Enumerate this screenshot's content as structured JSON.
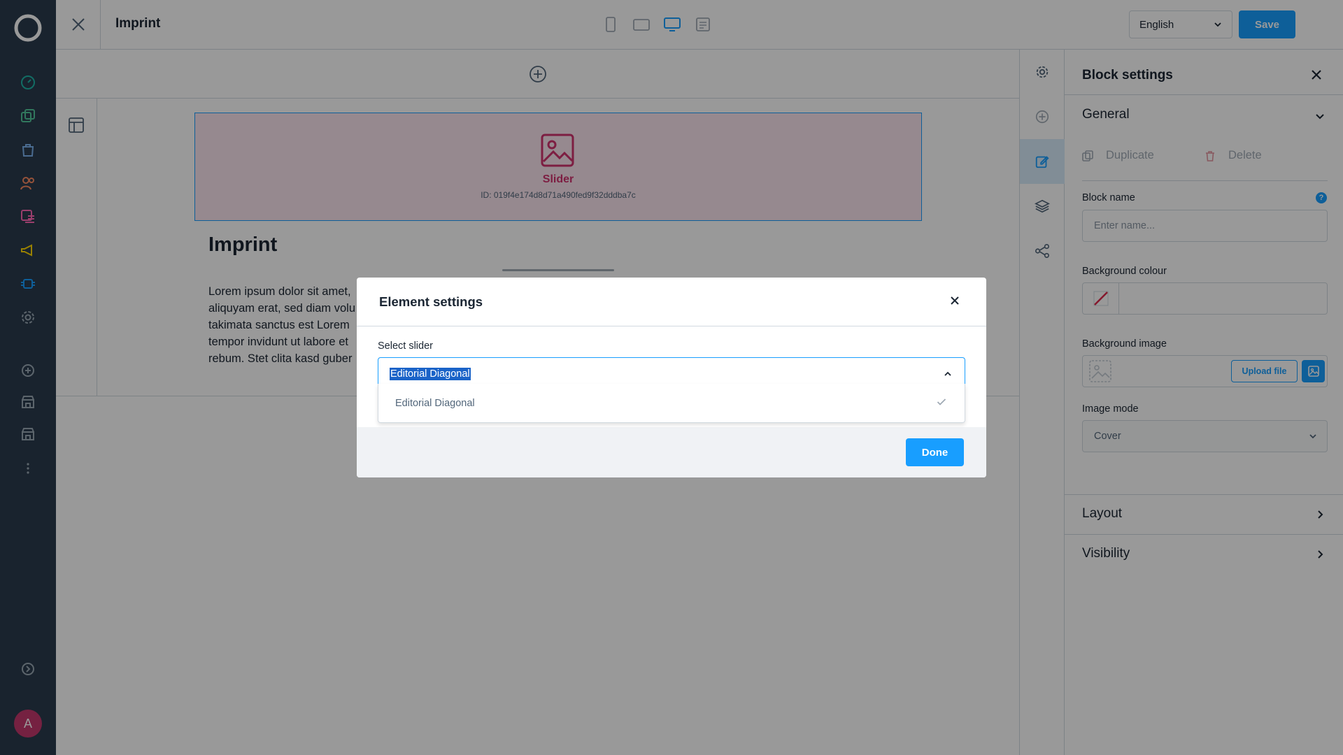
{
  "topbar": {
    "title": "Imprint",
    "language": "English",
    "save_label": "Save"
  },
  "stage": {
    "slider_label": "Slider",
    "slider_id": "ID: 019f4e174d8d71a490fed9f32dddba7c",
    "heading": "Imprint",
    "lorem_lines": [
      "Lorem ipsum dolor sit amet,",
      "aliquyam erat, sed diam volu",
      "takimata sanctus est Lorem",
      "tempor invidunt ut labore et",
      "rebum. Stet clita kasd guber"
    ]
  },
  "panel": {
    "title": "Block settings",
    "general_title": "General",
    "duplicate_label": "Duplicate",
    "delete_label": "Delete",
    "block_name_label": "Block name",
    "block_name_placeholder": "Enter name...",
    "help_mark": "?",
    "bg_colour_label": "Background colour",
    "bg_image_label": "Background image",
    "upload_label": "Upload file",
    "image_mode_label": "Image mode",
    "image_mode_value": "Cover",
    "layout_title": "Layout",
    "visibility_title": "Visibility"
  },
  "nav": {
    "avatar_initial": "A"
  },
  "modal": {
    "title": "Element settings",
    "select_label": "Select slider",
    "selected_value": "Editorial Diagonal",
    "options": [
      "Editorial Diagonal"
    ],
    "done_label": "Done"
  },
  "colors": {
    "accent": "#189eff",
    "nav_bg": "#2a3b4d",
    "slider_pink": "#d1326e",
    "overlay": "rgba(0,0,0,0.4)"
  }
}
